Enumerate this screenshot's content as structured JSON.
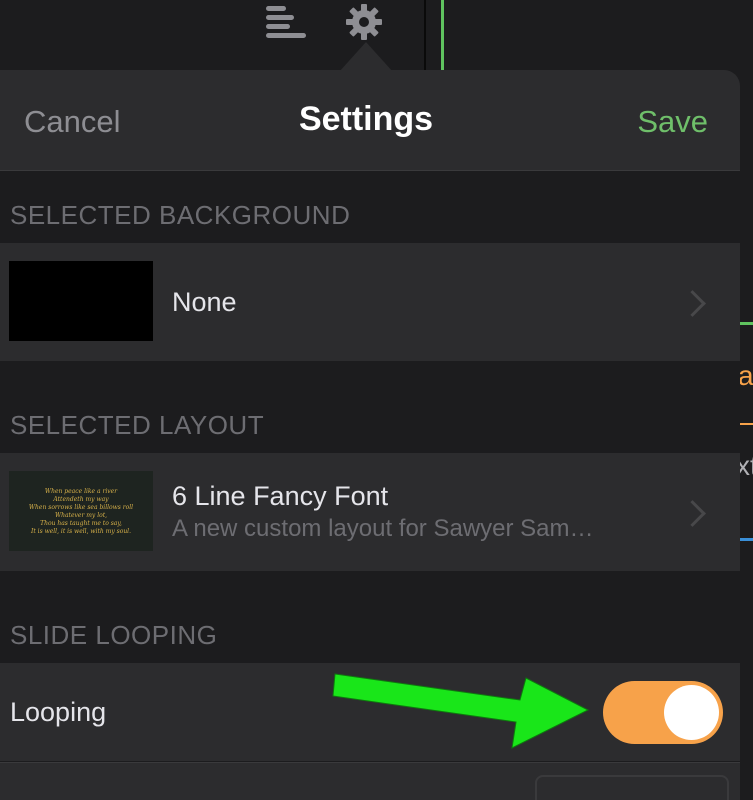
{
  "nav": {
    "cancel_label": "Cancel",
    "title": "Settings",
    "save_label": "Save"
  },
  "sections": {
    "background_header": "SELECTED BACKGROUND",
    "layout_header": "SELECTED LAYOUT",
    "looping_header": "SLIDE LOOPING"
  },
  "background_row": {
    "value": "None"
  },
  "layout_row": {
    "title": "6 Line Fancy Font",
    "subtitle": "A new custom layout for Sawyer Sam…",
    "thumbnail_lines": [
      "When peace like a river",
      "Attendeth my way",
      "When sorrows like sea billows roll",
      "Whatever my lot,",
      "Thou has taught me to say,",
      "It is well, it is well, with my soul."
    ]
  },
  "looping_row": {
    "label": "Looping",
    "enabled": true
  },
  "side_text": {
    "a": "a",
    "b": "xt"
  },
  "colors": {
    "accent_save": "#6fbf6a",
    "toggle_on": "#f7a24a",
    "annotation_arrow": "#19e619"
  },
  "icons": [
    "list-icon",
    "gear-icon",
    "chevron-right-icon",
    "annotation-arrow"
  ]
}
